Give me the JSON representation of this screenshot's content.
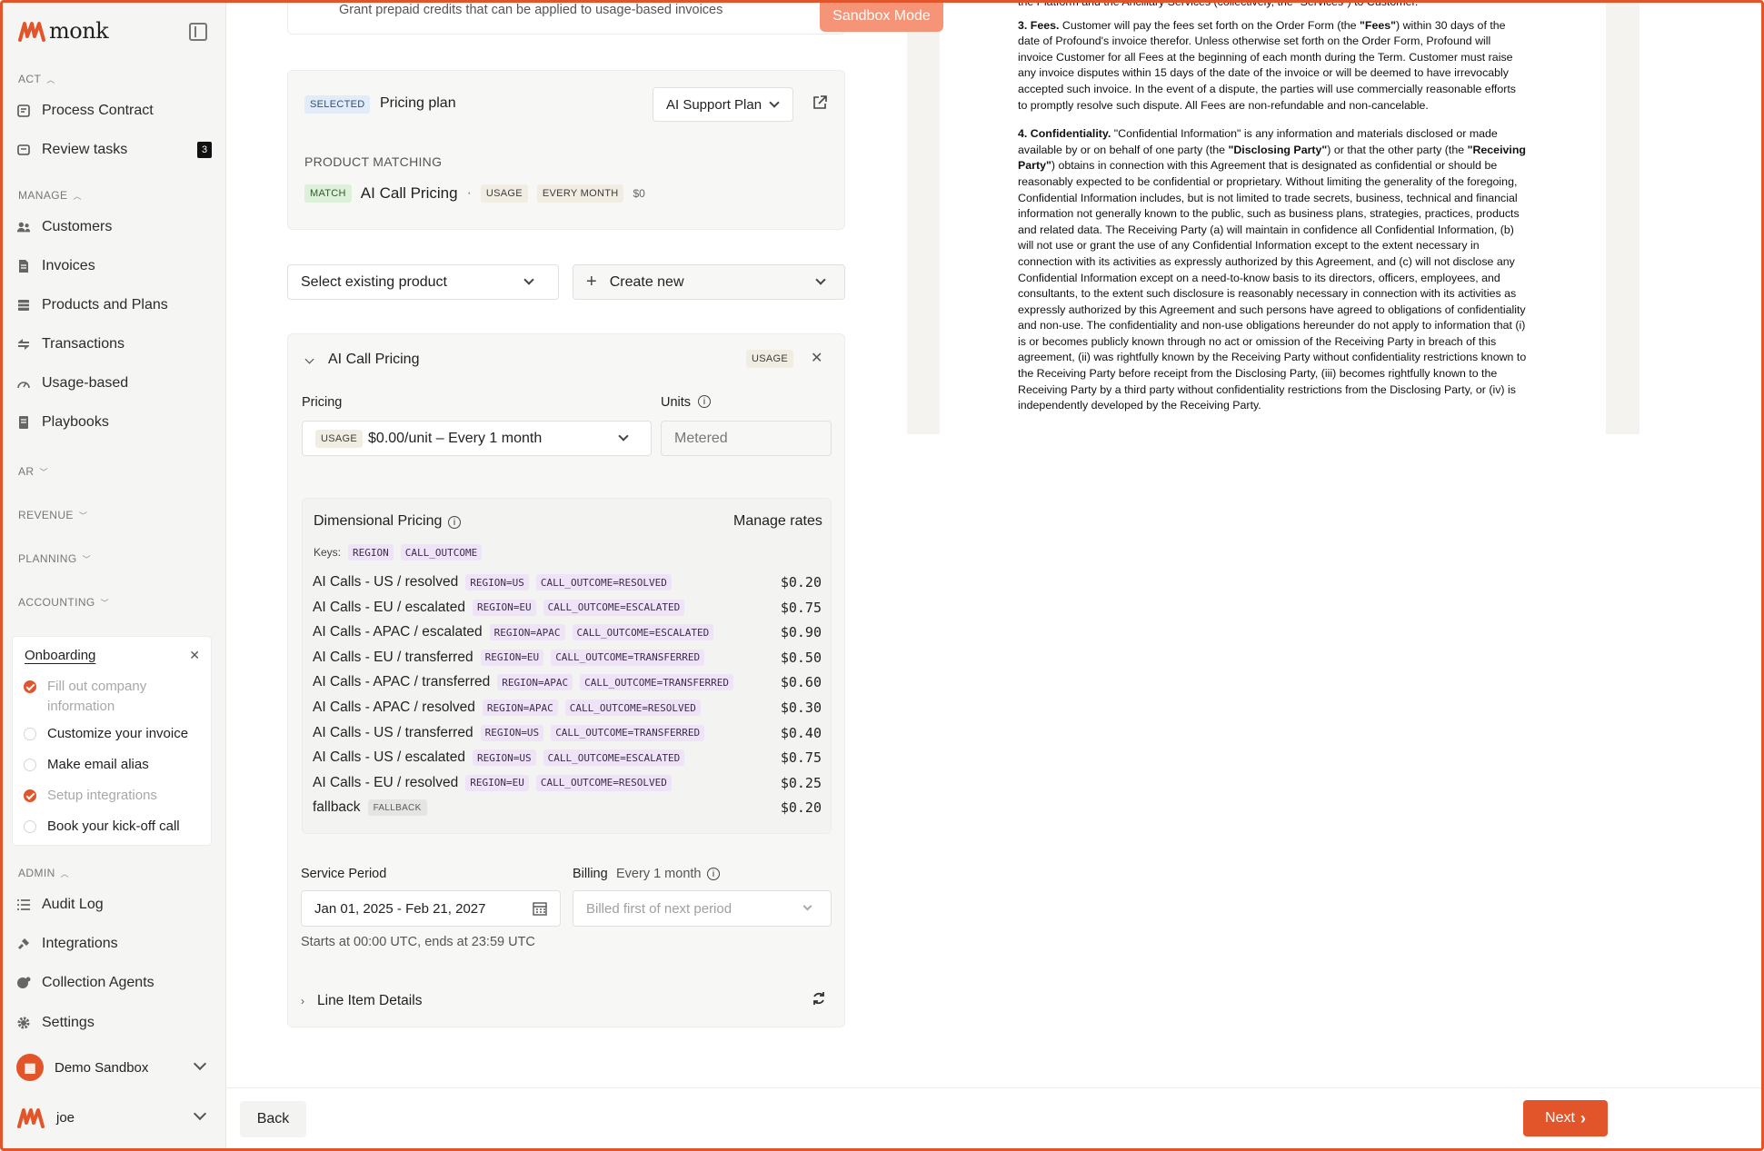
{
  "app": {
    "logo_text": "monk"
  },
  "sidebar": {
    "sections": {
      "act": "ACT",
      "manage": "MANAGE",
      "ar": "AR",
      "revenue": "REVENUE",
      "planning": "PLANNING",
      "accounting": "ACCOUNTING",
      "admin": "ADMIN"
    },
    "act_items": [
      {
        "label": "Process Contract",
        "icon": "contract-icon"
      },
      {
        "label": "Review tasks",
        "icon": "tasks-icon",
        "badge": "3"
      }
    ],
    "manage_items": [
      {
        "label": "Customers",
        "icon": "users-icon"
      },
      {
        "label": "Invoices",
        "icon": "invoice-icon"
      },
      {
        "label": "Products and Plans",
        "icon": "products-icon"
      },
      {
        "label": "Transactions",
        "icon": "transactions-icon"
      },
      {
        "label": "Usage-based",
        "icon": "gauge-icon"
      },
      {
        "label": "Playbooks",
        "icon": "book-icon"
      }
    ],
    "admin_items": [
      {
        "label": "Audit Log",
        "icon": "list-icon"
      },
      {
        "label": "Integrations",
        "icon": "plug-icon"
      },
      {
        "label": "Collection Agents",
        "icon": "agent-icon"
      },
      {
        "label": "Settings",
        "icon": "gear-icon"
      }
    ],
    "onboarding": {
      "title": "Onboarding",
      "items": [
        {
          "label": "Fill out company information",
          "done": true
        },
        {
          "label": "Customize your invoice",
          "done": false
        },
        {
          "label": "Make email alias",
          "done": false
        },
        {
          "label": "Setup integrations",
          "done": true
        },
        {
          "label": "Book your kick-off call",
          "done": false
        }
      ]
    },
    "workspace": "Demo Sandbox",
    "user": "joe"
  },
  "banner": {
    "sandbox": "Sandbox Mode"
  },
  "top_card": {
    "subtitle": "Grant prepaid credits that can be applied to usage-based invoices"
  },
  "plan_card": {
    "selected_badge": "SELECTED",
    "title": "Pricing plan",
    "plan_select": "AI Support Plan",
    "matching_label": "PRODUCT MATCHING",
    "match_badge": "MATCH",
    "product": "AI Call Pricing",
    "separator": "·",
    "usage_badge": "USAGE",
    "cadence_badge": "EVERY MONTH",
    "price": "$0"
  },
  "actions": {
    "select_existing": "Select existing product",
    "create_new": "Create new",
    "plus": "+"
  },
  "product_card": {
    "title": "AI Call Pricing",
    "usage_badge": "USAGE",
    "pricing_label": "Pricing",
    "units_label": "Units",
    "pricing_badge": "USAGE",
    "pricing_value": "$0.00/unit – Every 1 month",
    "units_value": "Metered",
    "dimensional": {
      "title": "Dimensional Pricing",
      "manage": "Manage rates",
      "keys_label": "Keys:",
      "keys": [
        "REGION",
        "CALL_OUTCOME"
      ],
      "rows": [
        {
          "name": "AI Calls - US / resolved",
          "tags": [
            "REGION=US",
            "CALL_OUTCOME=RESOLVED"
          ],
          "value": "$0.20"
        },
        {
          "name": "AI Calls - EU / escalated",
          "tags": [
            "REGION=EU",
            "CALL_OUTCOME=ESCALATED"
          ],
          "value": "$0.75"
        },
        {
          "name": "AI Calls - APAC / escalated",
          "tags": [
            "REGION=APAC",
            "CALL_OUTCOME=ESCALATED"
          ],
          "value": "$0.90"
        },
        {
          "name": "AI Calls - EU / transferred",
          "tags": [
            "REGION=EU",
            "CALL_OUTCOME=TRANSFERRED"
          ],
          "value": "$0.50"
        },
        {
          "name": "AI Calls - APAC / transferred",
          "tags": [
            "REGION=APAC",
            "CALL_OUTCOME=TRANSFERRED"
          ],
          "value": "$0.60"
        },
        {
          "name": "AI Calls - APAC / resolved",
          "tags": [
            "REGION=APAC",
            "CALL_OUTCOME=RESOLVED"
          ],
          "value": "$0.30"
        },
        {
          "name": "AI Calls - US / transferred",
          "tags": [
            "REGION=US",
            "CALL_OUTCOME=TRANSFERRED"
          ],
          "value": "$0.40"
        },
        {
          "name": "AI Calls - US / escalated",
          "tags": [
            "REGION=US",
            "CALL_OUTCOME=ESCALATED"
          ],
          "value": "$0.75"
        },
        {
          "name": "AI Calls - EU / resolved",
          "tags": [
            "REGION=EU",
            "CALL_OUTCOME=RESOLVED"
          ],
          "value": "$0.25"
        }
      ],
      "fallback": {
        "name": "fallback",
        "tag": "FALLBACK",
        "value": "$0.20"
      }
    },
    "service_label": "Service Period",
    "service_value": "Jan 01, 2025 - Feb 21, 2027",
    "billing_label": "Billing",
    "billing_cadence": "Every 1 month",
    "billing_placeholder": "Billed first of next period",
    "service_hint": "Starts at 00:00 UTC, ends at 23:59 UTC",
    "line_item_details": "Line Item Details"
  },
  "document": {
    "top_fragment": "the Platform and the Ancillary Services (collectively, the \"Services\") to Customer.",
    "fees_heading": "3. Fees.",
    "fees_text": " Customer will pay the fees set forth on the Order Form (the ",
    "fees_term": "\"Fees\"",
    "fees_text2": ") within 30 days of the date of Profound's invoice therefor. Unless otherwise set forth on the Order Form, Profound will invoice Customer for all Fees at the beginning of each month during the Term. Customer must raise any invoice disputes within 15 days of the date of the invoice or will be deemed to have irrevocably accepted such invoice. In the event of a dispute, the parties will use commercially reasonable efforts to promptly resolve such dispute. All Fees are non-refundable and non-cancelable.",
    "conf_heading": "4. Confidentiality.",
    "conf_text1": " \"Confidential Information\" is any information and materials disclosed or made available by or on behalf of one party (the ",
    "conf_term1": "\"Disclosing Party\"",
    "conf_text2": ") or that the other party (the ",
    "conf_term2": "\"Receiving Party\"",
    "conf_text3": ") obtains in connection with this Agreement that is designated as confidential or should be reasonably expected to be confidential or proprietary. Without limiting the generality of the foregoing, Confidential Information includes, but is not limited to trade secrets, business, technical and financial information not generally known to the public, such as business plans, strategies, practices, products and related data. The Receiving Party (a) will maintain in confidence all Confidential Information, (b) will not use or grant the use of any Confidential Information except to the extent necessary in connection with its activities as expressly authorized by this Agreement, and (c) will not disclose any Confidential Information except on a need-to-know basis to its directors, officers, employees, and consultants, to the extent such disclosure is reasonably necessary in connection with its activities as expressly authorized by this Agreement and such persons have agreed to obligations of confidentiality and non-use. The confidentiality and non-use obligations hereunder do not apply to information that (i) is or becomes publicly known through no act or omission of the Receiving Party in breach of this agreement, (ii) was rightfully known by the Receiving Party without confidentiality restrictions known to the Receiving Party before receipt from the Disclosing Party, (iii) becomes rightfully known to the Receiving Party by a third party without confidentiality restrictions from the Disclosing Party, or (iv) is independently developed by the Receiving Party."
  },
  "footer": {
    "back": "Back",
    "next": "Next"
  },
  "colors": {
    "accent": "#e2552a",
    "sandbox": "#f59476"
  }
}
